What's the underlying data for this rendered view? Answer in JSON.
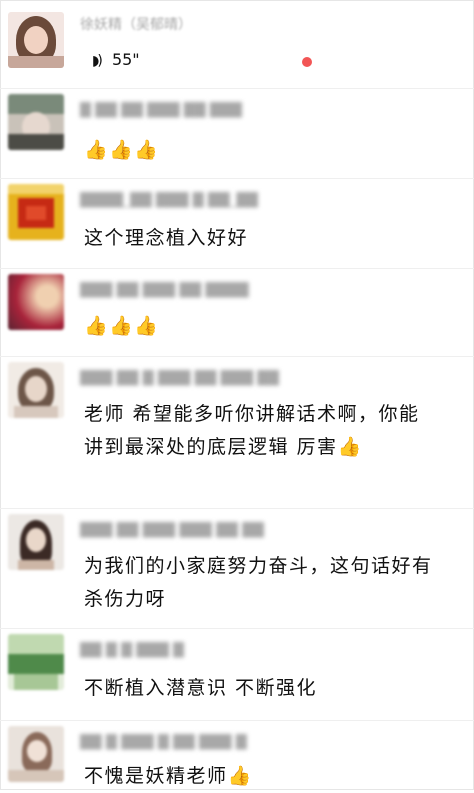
{
  "first": {
    "sender": "徐妖精（吴郁晴）",
    "voice_duration": "55\"",
    "voice_icon": "sound-wave-icon",
    "unread_color": "#f25555"
  },
  "comments": [
    {
      "sender": "█ ██ ██ ███ ██ ███",
      "text": "👍👍👍",
      "avatar_colors": [
        "#7a8a7a",
        "#c9c2b9",
        "#4c4c46"
      ]
    },
    {
      "sender": "████_██ ███ █ ██_██",
      "text": "这个理念植入好好",
      "avatar_colors": [
        "#e6b21d",
        "#c62a14",
        "#f2d36b"
      ]
    },
    {
      "sender": "███ ██ ███ ██ ████",
      "text": "👍👍👍",
      "avatar_colors": [
        "#a8233a",
        "#e9c8a6",
        "#5a2432"
      ]
    },
    {
      "sender": "███ ██ █ ███ ██ ███ ██",
      "text": "老师 希望能多听你讲解话术啊，你能讲到最深处的底层逻辑 厉害👍",
      "avatar_colors": [
        "#d7c8bd",
        "#6d5648",
        "#f1ebe5"
      ]
    },
    {
      "sender": "███ ██ ███ ███ ██ ██",
      "text": "为我们的小家庭努力奋斗，这句话好有杀伤力呀",
      "avatar_colors": [
        "#ece8e4",
        "#3b2a25",
        "#cdb6a6"
      ]
    },
    {
      "sender": "██ █ █ ███ █",
      "text": "不断植入潜意识 不断强化",
      "avatar_colors": [
        "#c0d9b0",
        "#4f8a4a",
        "#e2ecd9"
      ]
    },
    {
      "sender": "██ █ ███ █ ██ ███ █",
      "text": "不愧是妖精老师👍",
      "avatar_colors": [
        "#e9e2dc",
        "#8a6a5a",
        "#d6c6b9"
      ]
    }
  ]
}
